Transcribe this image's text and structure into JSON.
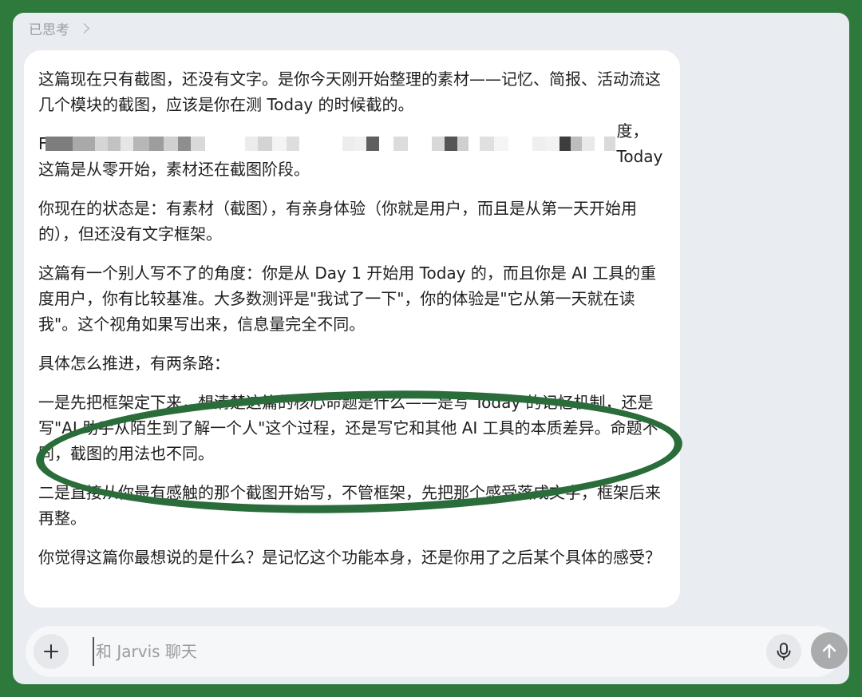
{
  "thinking": {
    "label": "已思考"
  },
  "message": {
    "paragraphs": [
      "这篇现在只有截图，还没有文字。是你今天刚开始整理的素材——记忆、简报、活动流这几个模块的截图，应该是你在测 Today 的时候截的。",
      "",
      "你现在的状态是：有素材（截图），有亲身体验（你就是用户，而且是从第一天开始用的），但还没有文字框架。",
      "这篇有一个别人写不了的角度：你是从 Day 1 开始用 Today 的，而且你是 AI 工具的重度用户，你有比较基准。大多数测评是\"我试了一下\"，你的体验是\"它从第一天就在读我\"。这个视角如果写出来，信息量完全不同。",
      "具体怎么推进，有两条路：",
      "一是先把框架定下来，想清楚这篇的核心命题是什么——是写 Today 的记忆机制，还是写\"AI 助手从陌生到了解一个人\"这个过程，还是写它和其他 AI 工具的本质差异。命题不同，截图的用法也不同。",
      "二是直接从你最有感触的那个截图开始写，不管框架，先把那个感受落成文字，框架后来再整。",
      "你觉得这篇你最想说的是什么？是记忆这个功能本身，还是你用了之后某个具体的感受？"
    ],
    "redacted": {
      "prefix": "F",
      "suffix": "度，Today",
      "line2": "这篇是从零开始，素材还在截图阶段。"
    }
  },
  "input": {
    "placeholder": "和 Jarvis 聊天"
  },
  "icons": {
    "plus": "plus-icon",
    "mic": "microphone-icon",
    "send": "arrow-up-icon",
    "chevron": "chevron-right-icon"
  },
  "colors": {
    "frame": "#2e7a3d",
    "highlight": "#2a6c3a"
  }
}
